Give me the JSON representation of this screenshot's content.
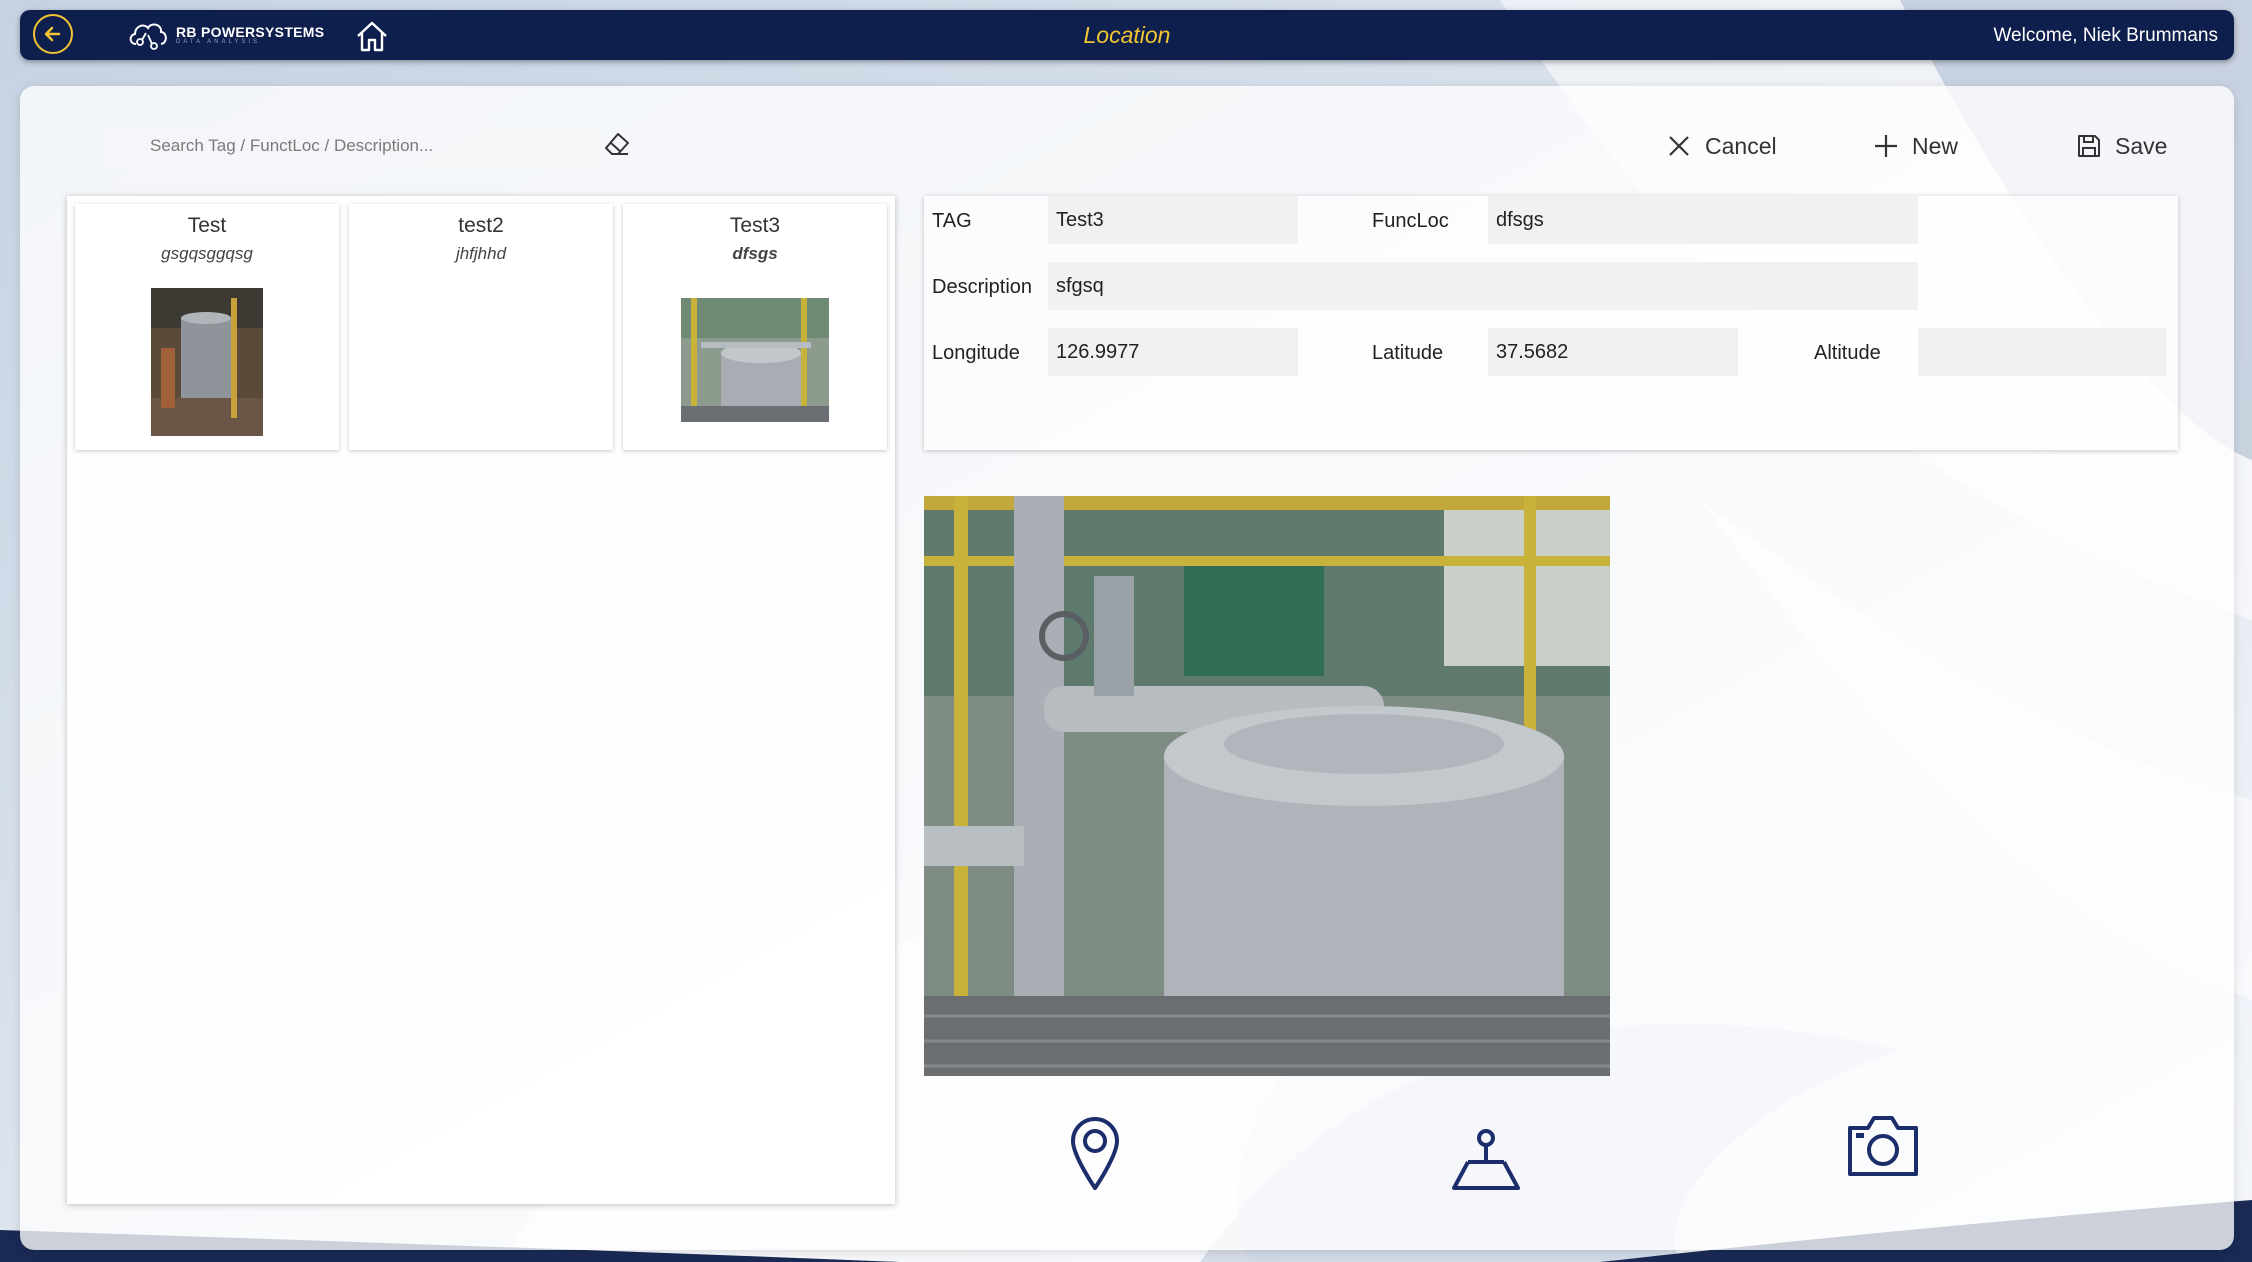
{
  "header": {
    "brand_name": "RB POWERSYSTEMS",
    "brand_tagline": "DATA ANALYSIS",
    "title": "Location",
    "welcome": "Welcome, Niek Brummans"
  },
  "search": {
    "placeholder": "Search Tag / FunctLoc / Description..."
  },
  "toolbar": {
    "cancel_label": "Cancel",
    "new_label": "New",
    "save_label": "Save"
  },
  "items": [
    {
      "tag": "Test",
      "funcloc": "gsgqsggqsg",
      "has_image": true
    },
    {
      "tag": "test2",
      "funcloc": "jhfjhhd",
      "has_image": false
    },
    {
      "tag": "Test3",
      "funcloc": "dfsgs",
      "has_image": true,
      "selected": true
    }
  ],
  "form": {
    "tag_label": "TAG",
    "tag_value": "Test3",
    "funcloc_label": "FuncLoc",
    "funcloc_value": "dfsgs",
    "description_label": "Description",
    "description_value": "sfgsq",
    "longitude_label": "Longitude",
    "longitude_value": "126.9977",
    "latitude_label": "Latitude",
    "latitude_value": "37.5682",
    "altitude_label": "Altitude",
    "altitude_value": ""
  },
  "icons": {
    "back": "arrow-left-icon",
    "home": "home-icon",
    "eraser": "eraser-icon",
    "cancel": "close-icon",
    "new": "plus-icon",
    "save": "floppy-disk-icon",
    "location": "map-pin-icon",
    "survey": "surveyor-icon",
    "camera": "camera-icon"
  },
  "colors": {
    "header_bg": "#0f1f4d",
    "accent_yellow": "#f1c531",
    "icon_navy": "#1b2d6b"
  }
}
